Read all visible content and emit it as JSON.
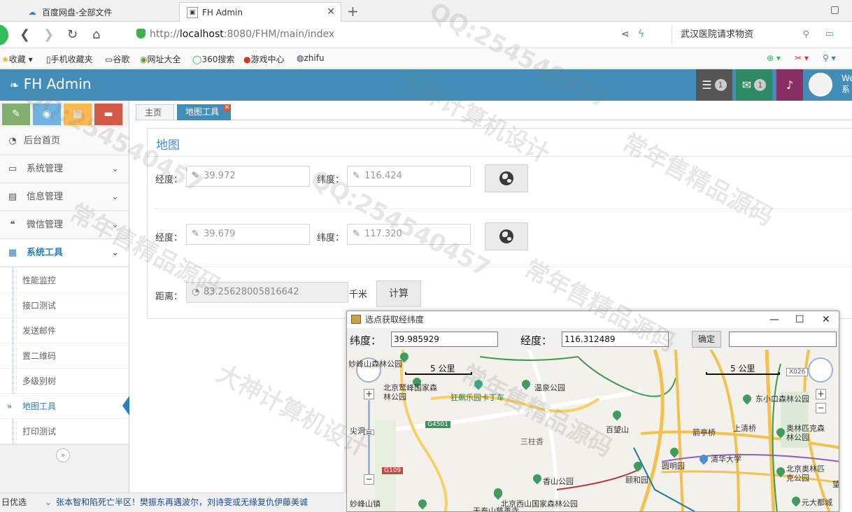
{
  "browser": {
    "tabs": [
      {
        "label": "百度网盘-全部文件"
      },
      {
        "label": "FH Admin"
      }
    ],
    "url_prefix": "http://",
    "url_host": "localhost",
    "url_rest": ":8080/FHM/main/index",
    "search_text": "武汉医院请求物资",
    "bookmarks": [
      "收藏",
      "手机收藏夹",
      "谷歌",
      "网址大全",
      "360搜索",
      "游戏中心",
      "zhifu"
    ]
  },
  "navbar": {
    "brand": "FH Admin",
    "task_count": "1",
    "mail_count": "1",
    "user_partial_1": "We",
    "user_partial_2": "系"
  },
  "sidebar": {
    "items": [
      {
        "label": "后台首页",
        "icon": "dashboard-icon"
      },
      {
        "label": "系统管理",
        "icon": "desktop-icon"
      },
      {
        "label": "信息管理",
        "icon": "list-icon"
      },
      {
        "label": "微信管理",
        "icon": "comments-icon"
      },
      {
        "label": "系统工具",
        "icon": "grid-icon"
      }
    ],
    "subitems": [
      "性能监控",
      "接口测试",
      "发送邮件",
      "置二维码",
      "多级别树",
      "地图工具",
      "打印测试"
    ],
    "active_subitem": "地图工具"
  },
  "page_tabs": {
    "home": "主页",
    "current": "地图工具"
  },
  "panel": {
    "title": "地图",
    "lng_label": "经度：",
    "lat_label": "纬度：",
    "row1_lng": "39.972",
    "row1_lat": "116.424",
    "row2_lng": "39.679",
    "row2_lat": "117.320",
    "distance_label": "距离：",
    "distance_value": "83.25628005816642",
    "distance_unit": "千米",
    "calc_button": "计算"
  },
  "map_window": {
    "title": "选点获取经纬度",
    "lat_label": "纬度：",
    "lat_value": "39.985929",
    "lng_label": "经度：",
    "lng_value": "116.312489",
    "ok_button": "确定",
    "extra_value": "",
    "scale_left": "5 公里",
    "scale_right": "5 公里",
    "places": [
      "妙峰山森林公园",
      "北京鹫峰国家森林公园",
      "狂飙乐园卡丁车",
      "温泉公园",
      "百望山",
      "三柱香",
      "香山公园",
      "颐和园",
      "圆明园",
      "清华大学",
      "箭亭桥",
      "上清桥",
      "东小口森林公园",
      "奥林匹克森林公园",
      "北京奥林匹克公园",
      "北京西山国家森林公园",
      "天泰山慈善寺",
      "元大都城",
      "妙峰山镇",
      "尖洞",
      "望"
    ],
    "roads": [
      "G4501",
      "G109",
      "X026"
    ]
  },
  "statusbar": {
    "left": "日优选",
    "news": "张本智和陷死亡半区！樊振东再遇波尔，刘诗雯或无缘复仇伊藤美诚"
  },
  "watermarks": [
    "大神计算机设计",
    "常年售精品源码",
    "QQ:254540457"
  ],
  "colors": {
    "navbar": "#438eb9",
    "brand_text": "#ffffff",
    "shortcut_green": "#82af6f",
    "shortcut_blue": "#6fb3e0",
    "shortcut_orange": "#ffb752",
    "shortcut_red": "#d15b47",
    "active_blue": "#2b7dbc"
  }
}
